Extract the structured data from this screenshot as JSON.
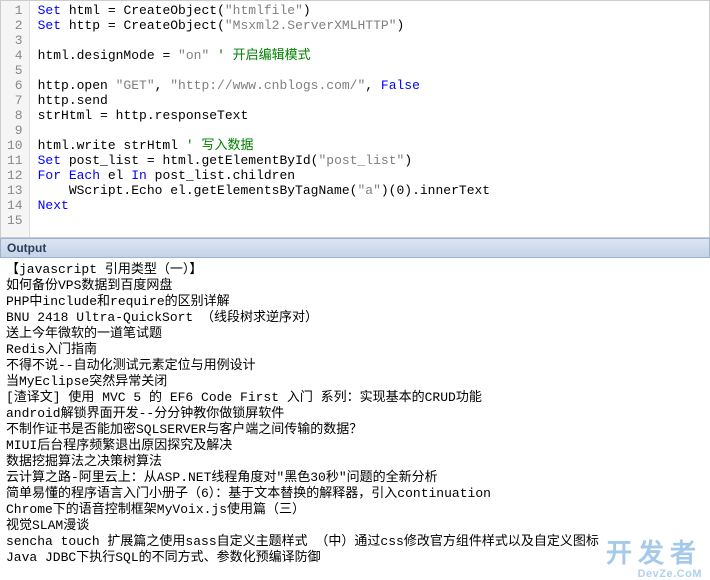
{
  "editor": {
    "lines": [
      {
        "n": 1,
        "tokens": [
          [
            "kw",
            "Set"
          ],
          [
            "",
            " html "
          ],
          [
            "op",
            "= "
          ],
          [
            "fn",
            "CreateObject"
          ],
          [
            "",
            "("
          ],
          [
            "str",
            "\"htmlfile\""
          ],
          [
            "",
            ")"
          ]
        ]
      },
      {
        "n": 2,
        "tokens": [
          [
            "kw",
            "Set"
          ],
          [
            "",
            " http "
          ],
          [
            "op",
            "= "
          ],
          [
            "fn",
            "CreateObject"
          ],
          [
            "",
            "("
          ],
          [
            "str",
            "\"Msxml2.ServerXMLHTTP\""
          ],
          [
            "",
            ")"
          ]
        ]
      },
      {
        "n": 3,
        "tokens": [
          [
            "",
            ""
          ]
        ]
      },
      {
        "n": 4,
        "tokens": [
          [
            "",
            "html.designMode "
          ],
          [
            "op",
            "= "
          ],
          [
            "str",
            "\"on\""
          ],
          [
            "",
            " "
          ],
          [
            "cmt",
            "' 开启编辑模式"
          ]
        ]
      },
      {
        "n": 5,
        "tokens": [
          [
            "",
            ""
          ]
        ]
      },
      {
        "n": 6,
        "tokens": [
          [
            "",
            "http.open "
          ],
          [
            "str",
            "\"GET\""
          ],
          [
            "",
            ", "
          ],
          [
            "str",
            "\"http://www.cnblogs.com/\""
          ],
          [
            "",
            ", "
          ],
          [
            "kw",
            "False"
          ]
        ]
      },
      {
        "n": 7,
        "tokens": [
          [
            "",
            "http.send"
          ]
        ]
      },
      {
        "n": 8,
        "tokens": [
          [
            "",
            "strHtml "
          ],
          [
            "op",
            "= "
          ],
          [
            "",
            "http.responseText"
          ]
        ]
      },
      {
        "n": 9,
        "tokens": [
          [
            "",
            ""
          ]
        ]
      },
      {
        "n": 10,
        "tokens": [
          [
            "",
            "html.write strHtml "
          ],
          [
            "cmt",
            "' 写入数据"
          ]
        ]
      },
      {
        "n": 11,
        "tokens": [
          [
            "kw",
            "Set"
          ],
          [
            "",
            " post_list "
          ],
          [
            "op",
            "= "
          ],
          [
            "",
            "html.getElementById("
          ],
          [
            "str",
            "\"post_list\""
          ],
          [
            "",
            ")"
          ]
        ]
      },
      {
        "n": 12,
        "tokens": [
          [
            "kw",
            "For Each"
          ],
          [
            "",
            " el "
          ],
          [
            "kw",
            "In"
          ],
          [
            "",
            " post_list.children"
          ]
        ]
      },
      {
        "n": 13,
        "tokens": [
          [
            "",
            "    WScript.Echo el.getElementsByTagName("
          ],
          [
            "str",
            "\"a\""
          ],
          [
            "",
            ")(0).innerText"
          ]
        ]
      },
      {
        "n": 14,
        "tokens": [
          [
            "kw",
            "Next"
          ]
        ]
      },
      {
        "n": 15,
        "tokens": [
          [
            "",
            ""
          ]
        ]
      }
    ]
  },
  "output": {
    "title": "Output",
    "lines": [
      "【javascript 引用类型（一）】",
      "如何备份VPS数据到百度网盘",
      "PHP中include和require的区别详解",
      "BNU 2418 Ultra-QuickSort （线段树求逆序对）",
      "送上今年微软的一道笔试题",
      "Redis入门指南",
      "不得不说--自动化测试元素定位与用例设计",
      "当MyEclipse突然异常关闭",
      "[渣译文] 使用 MVC 5 的 EF6 Code First 入门 系列：实现基本的CRUD功能",
      "android解锁界面开发--分分钟教你做锁屏软件",
      "不制作证书是否能加密SQLSERVER与客户端之间传输的数据？",
      "MIUI后台程序频繁退出原因探究及解决",
      "数据挖掘算法之决策树算法",
      "云计算之路-阿里云上：从ASP.NET线程角度对\"黑色30秒\"问题的全新分析",
      "简单易懂的程序语言入门小册子（6）：基于文本替换的解释器，引入continuation",
      "Chrome下的语音控制框架MyVoix.js使用篇（三）",
      "视觉SLAM漫谈",
      "sencha touch 扩展篇之使用sass自定义主题样式 （中）通过css修改官方组件样式以及自定义图标",
      "Java JDBC下执行SQL的不同方式、参数化预编译防御"
    ]
  },
  "watermark": {
    "main": "开发者",
    "sub": "DevZe.CoM"
  }
}
